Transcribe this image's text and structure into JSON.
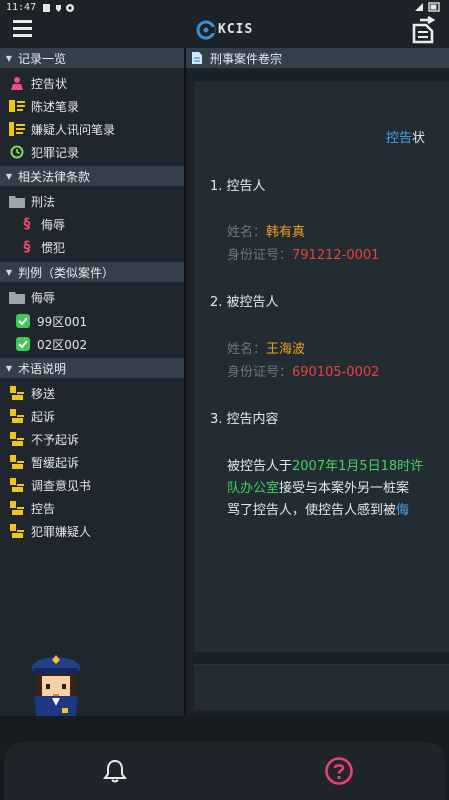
{
  "status": {
    "time": "11:47"
  },
  "header": {
    "logo_text": "KCIS"
  },
  "sidebar": {
    "sections": [
      {
        "title": "记录一览",
        "items": [
          {
            "label": "控告状",
            "icon": "person-pink-icon"
          },
          {
            "label": "陈述笔录",
            "icon": "statement-icon"
          },
          {
            "label": "嫌疑人讯问笔录",
            "icon": "interrogation-icon"
          },
          {
            "label": "犯罪记录",
            "icon": "history-icon"
          }
        ]
      },
      {
        "title": "相关法律条款",
        "items": [
          {
            "label": "刑法",
            "icon": "folder-icon"
          },
          {
            "label": "侮辱",
            "icon": "law-section-icon"
          },
          {
            "label": "惯犯",
            "icon": "law-section-icon"
          }
        ]
      },
      {
        "title": "判例（类似案件）",
        "items": [
          {
            "label": "侮辱",
            "icon": "folder-icon"
          },
          {
            "label": "99区001",
            "icon": "check-icon"
          },
          {
            "label": "02区002",
            "icon": "check-icon"
          }
        ]
      },
      {
        "title": "术语说明",
        "items": [
          {
            "label": "移送",
            "icon": "term-icon"
          },
          {
            "label": "起诉",
            "icon": "term-icon"
          },
          {
            "label": "不予起诉",
            "icon": "term-icon"
          },
          {
            "label": "暂缓起诉",
            "icon": "term-icon"
          },
          {
            "label": "调查意见书",
            "icon": "term-icon"
          },
          {
            "label": "控告",
            "icon": "term-icon"
          },
          {
            "label": "犯罪嫌疑人",
            "icon": "term-icon"
          }
        ]
      }
    ]
  },
  "tab": {
    "title": "刑事案件卷宗"
  },
  "document": {
    "title_blue": "控告",
    "title_rest": "状",
    "s1": "1. 控告人",
    "complainant": {
      "name_label": "姓名：",
      "name": "韩有真",
      "id_label": "身份证号：",
      "id": "791212-0001"
    },
    "s2": "2. 被控告人",
    "accused": {
      "name_label": "姓名：",
      "name": "王海波",
      "id_label": "身份证号：",
      "id": "690105-0002"
    },
    "s3": "3. 控告内容",
    "p1_pre": "被控告人于",
    "p1_green": "2007年1月5日18时许",
    "p2_green": "队办公室",
    "p2_rest": "接受与本案外另一桩案",
    "p3_pre": "骂了控告人，使控告人感到被",
    "p3_blue": "侮"
  },
  "colors": {
    "accent_blue": "#4aa3e8",
    "green": "#41d35d",
    "orange": "#f0a020",
    "red": "#e8443b",
    "help_pink": "#e8407a"
  }
}
